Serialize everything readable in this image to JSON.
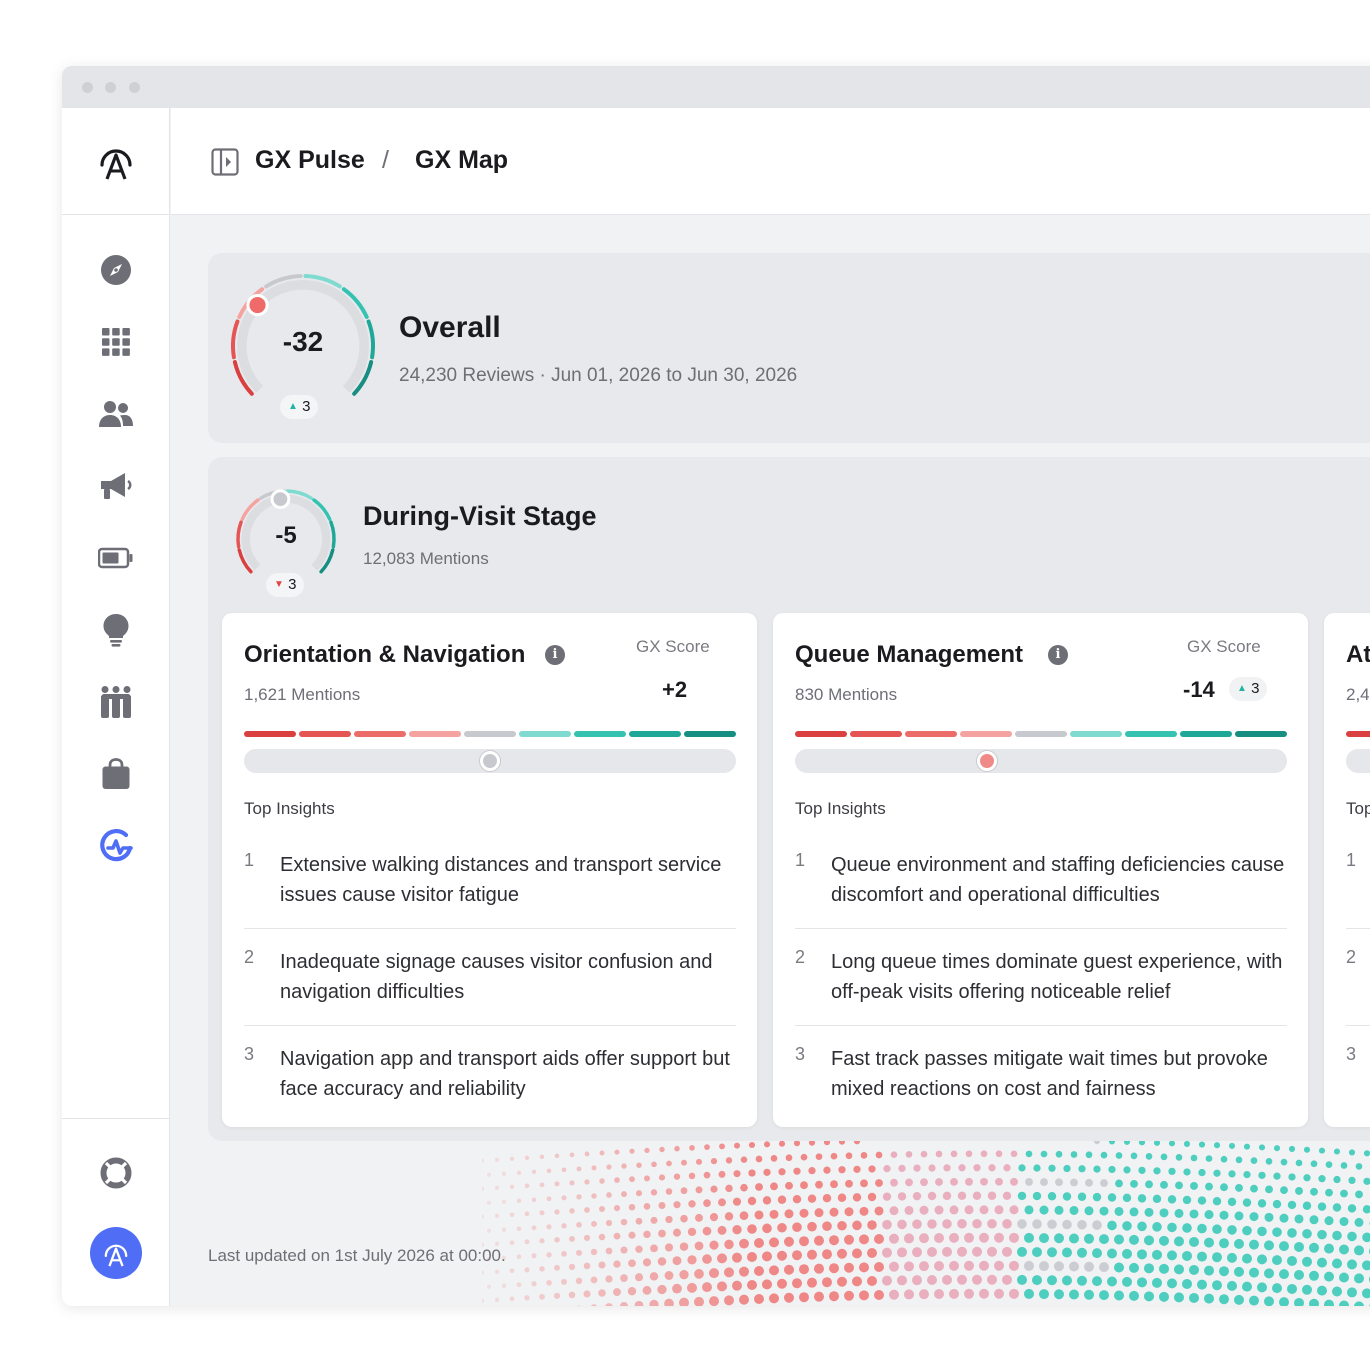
{
  "breadcrumb": {
    "app": "GX Pulse",
    "separator": "/",
    "page": "GX Map"
  },
  "overall": {
    "score": "-32",
    "delta": "3",
    "delta_direction": "up",
    "title": "Overall",
    "reviews": "24,230 Reviews · Jun 01, 2026 to Jun 30, 2026"
  },
  "stage": {
    "score": "-5",
    "delta": "3",
    "delta_direction": "down",
    "title": "During-Visit Stage",
    "mentions": "12,083 Mentions"
  },
  "cards": [
    {
      "title": "Orientation & Navigation",
      "gx_label": "GX Score",
      "mentions": "1,621 Mentions",
      "score": "+2",
      "score_position_pct": 50,
      "knob_color": "#c8c9ce",
      "insights_label": "Top Insights",
      "insights": [
        {
          "n": "1",
          "text": "Extensive walking distances and transport service issues cause visitor fatigue"
        },
        {
          "n": "2",
          "text": "Inadequate signage causes visitor confusion and navigation difficulties"
        },
        {
          "n": "3",
          "text": "Navigation app and transport aids offer support but face accuracy and reliability"
        }
      ]
    },
    {
      "title": "Queue Management",
      "gx_label": "GX Score",
      "mentions": "830 Mentions",
      "score": "-14",
      "delta": "3",
      "delta_direction": "up",
      "score_position_pct": 39,
      "knob_color": "#f08a88",
      "insights_label": "Top Insights",
      "insights": [
        {
          "n": "1",
          "text": "Queue environment and staffing deficiencies cause discomfort and operational difficulties"
        },
        {
          "n": "2",
          "text": "Long queue times dominate guest experience, with off-peak visits offering noticeable relief"
        },
        {
          "n": "3",
          "text": "Fast track passes mitigate wait times but provoke mixed reactions on cost and fairness"
        }
      ]
    },
    {
      "title": "At",
      "mentions": "2,4",
      "insights_label": "Top",
      "insights": [
        {
          "n": "1"
        },
        {
          "n": "2"
        },
        {
          "n": "3"
        }
      ]
    }
  ],
  "scale_colors": [
    "#d9403f",
    "#e45553",
    "#ec6c69",
    "#f4a3a0",
    "#c8c9ce",
    "#7fdad0",
    "#35c2b1",
    "#1fa898",
    "#178e82"
  ],
  "footer": {
    "last_updated": "Last updated on 1st July 2026 at 00:00."
  },
  "nav": [
    "compass-icon",
    "grid-icon",
    "users-icon",
    "megaphone-icon",
    "battery-icon",
    "lightbulb-icon",
    "family-icon",
    "shopping-bag-icon",
    "pulse-logo-icon"
  ],
  "accent": "#4f6df5",
  "negative": "#e04545",
  "positive": "#22b3a3"
}
